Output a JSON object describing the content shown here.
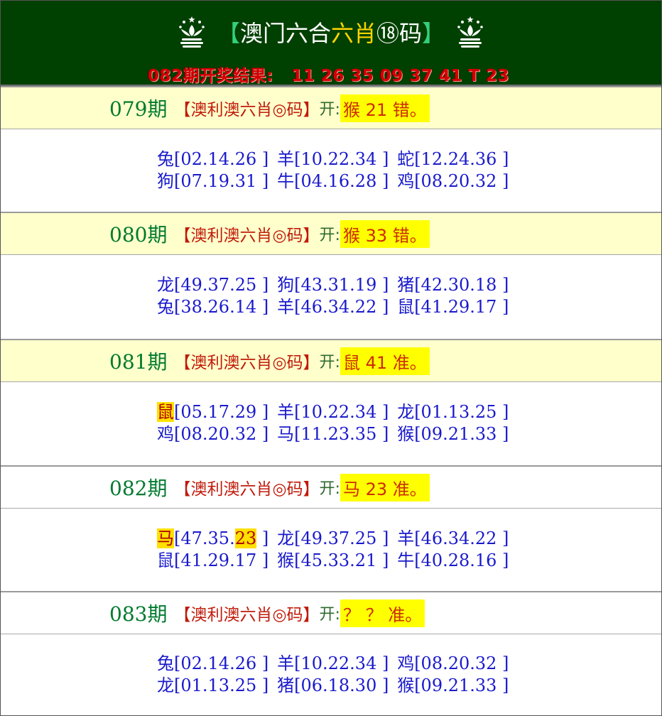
{
  "header": {
    "title_open": "【",
    "title_a": "澳门六合",
    "title_b": "六肖",
    "title_c": "⑱码",
    "title_close": "】",
    "result_label": "082期开奖结果:",
    "result_numbers": "11 26 35 09 37 41 T 23"
  },
  "rows": [
    {
      "period": "079期",
      "category": "【澳利澳六肖◎码】",
      "open_label": "开:",
      "result": "猴 21 错。",
      "picks": [
        {
          "zodiac": "兔",
          "nums": "[02.14.26 ]"
        },
        {
          "zodiac": "羊",
          "nums": "[10.22.34 ]"
        },
        {
          "zodiac": "蛇",
          "nums": "[12.24.36 ]"
        },
        {
          "zodiac": "狗",
          "nums": "[07.19.31 ]"
        },
        {
          "zodiac": "牛",
          "nums": "[04.16.28 ]"
        },
        {
          "zodiac": "鸡",
          "nums": "[08.20.32 ]"
        }
      ]
    },
    {
      "period": "080期",
      "category": "【澳利澳六肖◎码】",
      "open_label": "开:",
      "result": "猴 33 错。",
      "picks": [
        {
          "zodiac": "龙",
          "nums": "[49.37.25 ]"
        },
        {
          "zodiac": "狗",
          "nums": "[43.31.19 ]"
        },
        {
          "zodiac": "猪",
          "nums": "[42.30.18 ]"
        },
        {
          "zodiac": "兔",
          "nums": "[38.26.14 ]"
        },
        {
          "zodiac": "羊",
          "nums": "[46.34.22 ]"
        },
        {
          "zodiac": "鼠",
          "nums": "[41.29.17 ]"
        }
      ]
    },
    {
      "period": "081期",
      "category": "【澳利澳六肖◎码】",
      "open_label": "开:",
      "result": "鼠 41 准。",
      "picks": [
        {
          "zodiac": "鼠",
          "nums": "[05.17.29 ]"
        },
        {
          "zodiac": "羊",
          "nums": "[10.22.34 ]"
        },
        {
          "zodiac": "龙",
          "nums": "[01.13.25 ]"
        },
        {
          "zodiac": "鸡",
          "nums": "[08.20.32 ]"
        },
        {
          "zodiac": "马",
          "nums": "[11.23.35 ]"
        },
        {
          "zodiac": "猴",
          "nums": "[09.21.33 ]"
        }
      ]
    },
    {
      "period": "082期",
      "category": "【澳利澳六肖◎码】",
      "open_label": "开:",
      "result": "马 23 准。",
      "picks": [
        {
          "zodiac": "马",
          "nums_pre": "[47.35.",
          "nums_hl": "23",
          "nums_post": " ]"
        },
        {
          "zodiac": "龙",
          "nums": "[49.37.25 ]"
        },
        {
          "zodiac": "羊",
          "nums": "[46.34.22 ]"
        },
        {
          "zodiac": "鼠",
          "nums": "[41.29.17 ]"
        },
        {
          "zodiac": "猴",
          "nums": "[45.33.21 ]"
        },
        {
          "zodiac": "牛",
          "nums": "[40.28.16 ]"
        }
      ]
    },
    {
      "period": "083期",
      "category": "【澳利澳六肖◎码】",
      "open_label": "开:",
      "result": " ？ ？ 准。",
      "picks": [
        {
          "zodiac": "兔",
          "nums": "[02.14.26 ]"
        },
        {
          "zodiac": "羊",
          "nums": "[10.22.34 ]"
        },
        {
          "zodiac": "鸡",
          "nums": "[08.20.32 ]"
        },
        {
          "zodiac": "龙",
          "nums": "[01.13.25 ]"
        },
        {
          "zodiac": "猪",
          "nums": "[06.18.30 ]"
        },
        {
          "zodiac": "猴",
          "nums": "[09.21.33 ]"
        }
      ]
    }
  ],
  "colors": {
    "header_bg": "#004000",
    "title_accent": "#ffd400",
    "result_text": "#d10000",
    "period_text": "#007a2f",
    "category_text": "#c01a0a",
    "result_badge_bg": "#ffff00",
    "zodiac_text": "#1a1acc",
    "hit_highlight": "#ffe000"
  },
  "icons": [
    "macau-emblem-icon"
  ]
}
